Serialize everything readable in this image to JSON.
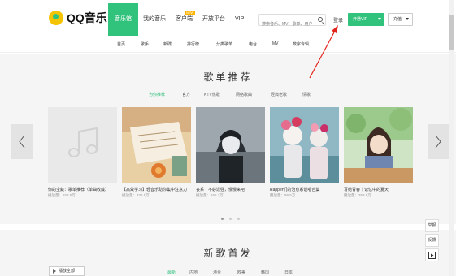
{
  "brand": {
    "name": "QQ音乐"
  },
  "header": {
    "nav": [
      {
        "label": "音乐馆",
        "active": true
      },
      {
        "label": "我的音乐"
      },
      {
        "label": "客户端",
        "badge": "NEW"
      },
      {
        "label": "开放平台"
      },
      {
        "label": "VIP"
      }
    ],
    "search": {
      "placeholder": "搜索音乐、MV、歌单、用户"
    },
    "login_label": "登录",
    "vip_button": "开通VIP",
    "recharge_button": "充值"
  },
  "subnav": [
    "首页",
    "歌手",
    "新碟",
    "排行榜",
    "分类歌单",
    "电台",
    "MV",
    "数字专辑"
  ],
  "playlist_section": {
    "title": "歌单推荐",
    "tabs": [
      {
        "label": "为你推荐",
        "active": true
      },
      {
        "label": "官方"
      },
      {
        "label": "KTV热歌"
      },
      {
        "label": "网络歌曲"
      },
      {
        "label": "经典老歌"
      },
      {
        "label": "情歌"
      }
    ],
    "cards": [
      {
        "title": "你的宝藏：歌单推荐（单曲收藏）",
        "plays": "播放量：928.5万"
      },
      {
        "title": "【高效学习】轻音乐助你集中注意力",
        "plays": "播放量：335.5万"
      },
      {
        "title": "丧系｜不必逞强，慢慢来吧",
        "plays": "播放量：165.3万"
      },
      {
        "title": "Rapper们的治愈系说唱合集",
        "plays": "播放量：86.5万"
      },
      {
        "title": "写给青春｜记忆中的夏天",
        "plays": "播放量：359.5万"
      }
    ],
    "pager": {
      "count": 3,
      "active": 0
    }
  },
  "new_songs_section": {
    "title": "新歌首发",
    "play_all": "播放全部",
    "tabs": [
      {
        "label": "最新",
        "active": true
      },
      {
        "label": "内地"
      },
      {
        "label": "港台"
      },
      {
        "label": "欧美"
      },
      {
        "label": "韩国"
      },
      {
        "label": "日本"
      }
    ]
  },
  "side_tools": [
    "举报",
    "反馈"
  ],
  "colors": {
    "accent": "#31c27c",
    "annotation": "#e0241b",
    "section_bg": "#f5f5f5",
    "badge": "#ffb400"
  },
  "icons": {
    "prev": "chevron-left-icon",
    "next": "chevron-right-icon",
    "search": "search-icon",
    "placeholder_cover": "music-note-icon",
    "play": "play-icon",
    "back_to_top": "back-to-top-icon"
  }
}
